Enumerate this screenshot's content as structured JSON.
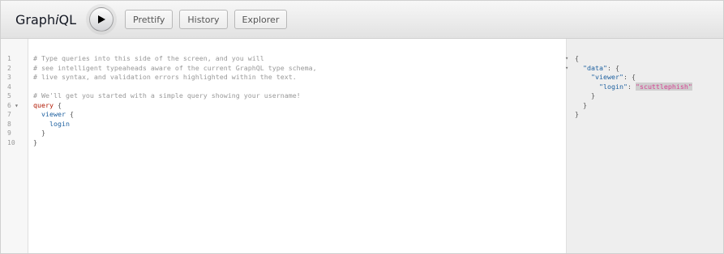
{
  "toolbar": {
    "title_prefix": "Graph",
    "title_italic": "i",
    "title_suffix": "QL",
    "execute_icon": "play-icon",
    "prettify_label": "Prettify",
    "history_label": "History",
    "explorer_label": "Explorer"
  },
  "editor": {
    "line_numbers": [
      "1",
      "2",
      "3",
      "4",
      "5",
      "6",
      "7",
      "8",
      "9",
      "10"
    ],
    "fold_markers": {
      "line6": "▾"
    },
    "lines": [
      {
        "text": "# Type queries into this side of the screen, and you will"
      },
      {
        "text": "# see intelligent typeaheads aware of the current GraphQL type schema,"
      },
      {
        "text": "# live syntax, and validation errors highlighted within the text."
      },
      {
        "text": ""
      },
      {
        "text": "# We'll get you started with a simple query showing your username!"
      },
      {
        "kw": "query",
        "rest": " {"
      },
      {
        "indent": "  ",
        "field": "viewer",
        "rest": " {"
      },
      {
        "indent": "    ",
        "field": "login",
        "rest": ""
      },
      {
        "indent": "  ",
        "field": "",
        "rest": "}"
      },
      {
        "indent": "",
        "field": "",
        "rest": "}"
      }
    ]
  },
  "results": {
    "fold_markers": [
      "▾",
      "▾"
    ],
    "lines": {
      "l1": "{",
      "l2_key": "\"data\"",
      "l2_rest": ": {",
      "l3_key": "\"viewer\"",
      "l3_rest": ": {",
      "l4_key": "\"login\"",
      "l4_sep": ": ",
      "l4_val": "\"scuttlephish\"",
      "l5": "}",
      "l6": "}",
      "l7": "}"
    }
  },
  "colors": {
    "comment": "#999999",
    "keyword": "#B11A04",
    "field": "#1F61A0",
    "string": "#D64292",
    "results_bg": "#eeeeee"
  }
}
